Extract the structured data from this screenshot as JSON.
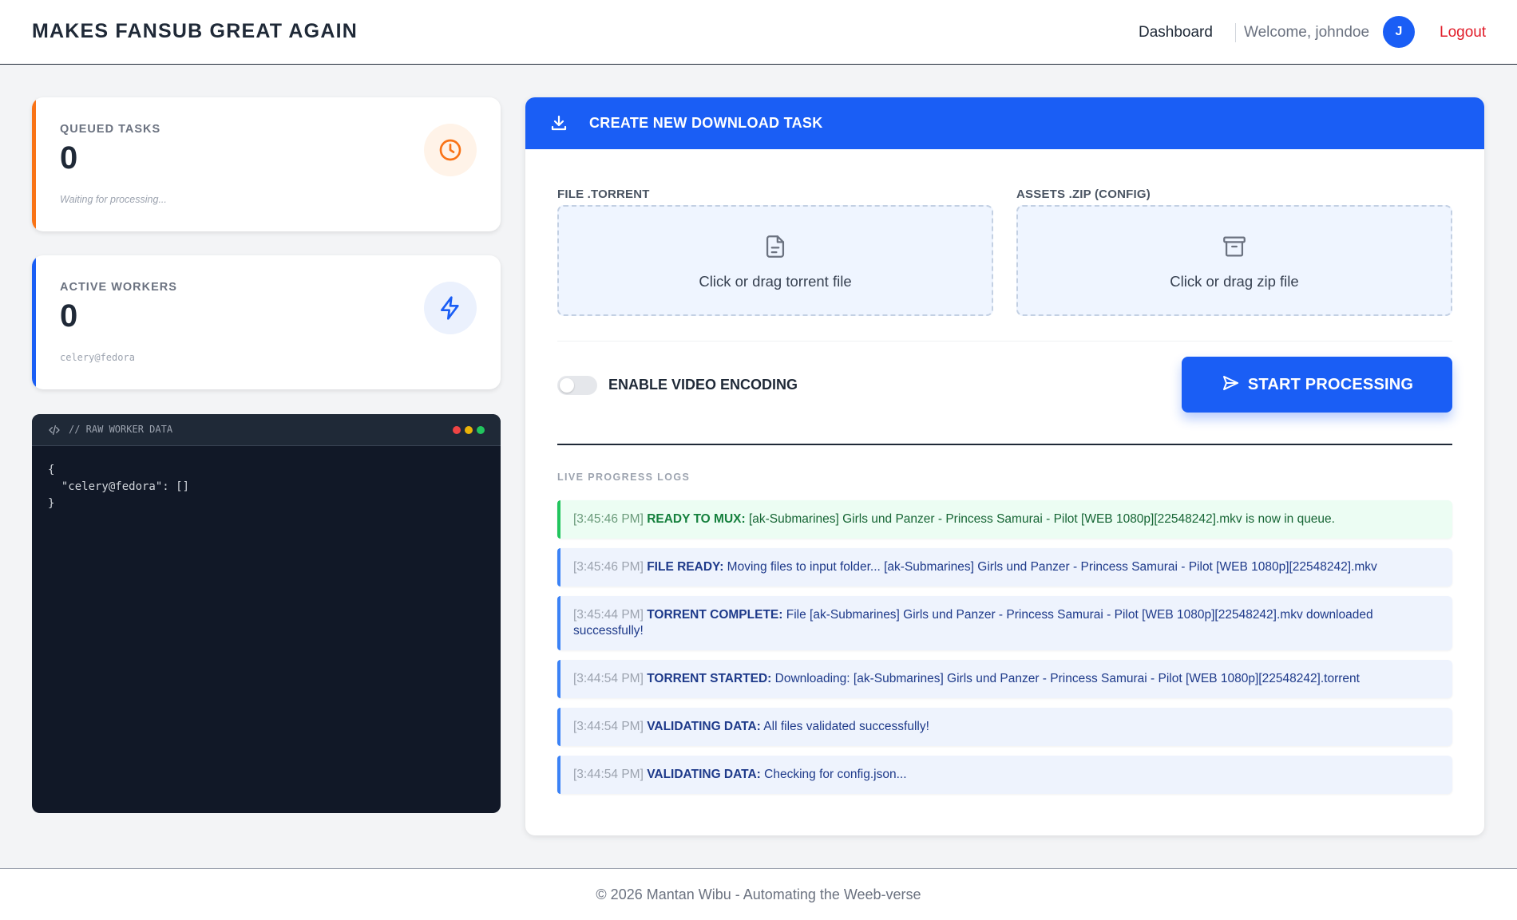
{
  "header": {
    "brand": "MAKES FANSUB GREAT AGAIN",
    "nav_dashboard": "Dashboard",
    "welcome": "Welcome, johndoe",
    "avatar_initial": "J",
    "logout": "Logout"
  },
  "stats": {
    "queued": {
      "label": "QUEUED TASKS",
      "value": "0",
      "sub": "Waiting for processing..."
    },
    "workers": {
      "label": "ACTIVE WORKERS",
      "value": "0",
      "sub": "celery@fedora"
    }
  },
  "terminal": {
    "title": "// RAW WORKER DATA",
    "content": "{\n  \"celery@fedora\": []\n}"
  },
  "panel": {
    "title": "CREATE NEW DOWNLOAD TASK",
    "torrent_label": "FILE .TORRENT",
    "torrent_hint": "Click or drag torrent file",
    "zip_label": "ASSETS .ZIP (CONFIG)",
    "zip_hint": "Click or drag zip file",
    "encoding_label": "ENABLE VIDEO ENCODING",
    "encoding_enabled": false,
    "start_label": "START PROCESSING",
    "logs_title": "LIVE PROGRESS LOGS"
  },
  "logs": [
    {
      "time": "[3:45:46 PM]",
      "status": "READY TO MUX:",
      "message": "[ak-Submarines] Girls und Panzer - Princess Samurai - Pilot [WEB 1080p][22548242].mkv is now in queue.",
      "kind": "success"
    },
    {
      "time": "[3:45:46 PM]",
      "status": "FILE READY:",
      "message": "Moving files to input folder... [ak-Submarines] Girls und Panzer - Princess Samurai - Pilot [WEB 1080p][22548242].mkv",
      "kind": "info"
    },
    {
      "time": "[3:45:44 PM]",
      "status": "TORRENT COMPLETE:",
      "message": "File [ak-Submarines] Girls und Panzer - Princess Samurai - Pilot [WEB 1080p][22548242].mkv downloaded successfully!",
      "kind": "info"
    },
    {
      "time": "[3:44:54 PM]",
      "status": "TORRENT STARTED:",
      "message": "Downloading: [ak-Submarines] Girls und Panzer - Princess Samurai - Pilot [WEB 1080p][22548242].torrent",
      "kind": "info"
    },
    {
      "time": "[3:44:54 PM]",
      "status": "VALIDATING DATA:",
      "message": "All files validated successfully!",
      "kind": "info"
    },
    {
      "time": "[3:44:54 PM]",
      "status": "VALIDATING DATA:",
      "message": "Checking for config.json...",
      "kind": "info"
    }
  ],
  "footer": {
    "text": "© 2026 Mantan Wibu - Automating the Weeb-verse"
  },
  "colors": {
    "primary": "#1a5ef5",
    "accent_orange": "#f97316",
    "success": "#22c55e",
    "danger": "#e11d2a",
    "terminal_bg": "#111827"
  },
  "icons": {
    "queued": "clock-icon",
    "workers": "lightning-icon",
    "panel": "download-icon",
    "torrent": "file-icon",
    "zip": "archive-icon",
    "start": "send-icon",
    "terminal": "code-icon"
  }
}
